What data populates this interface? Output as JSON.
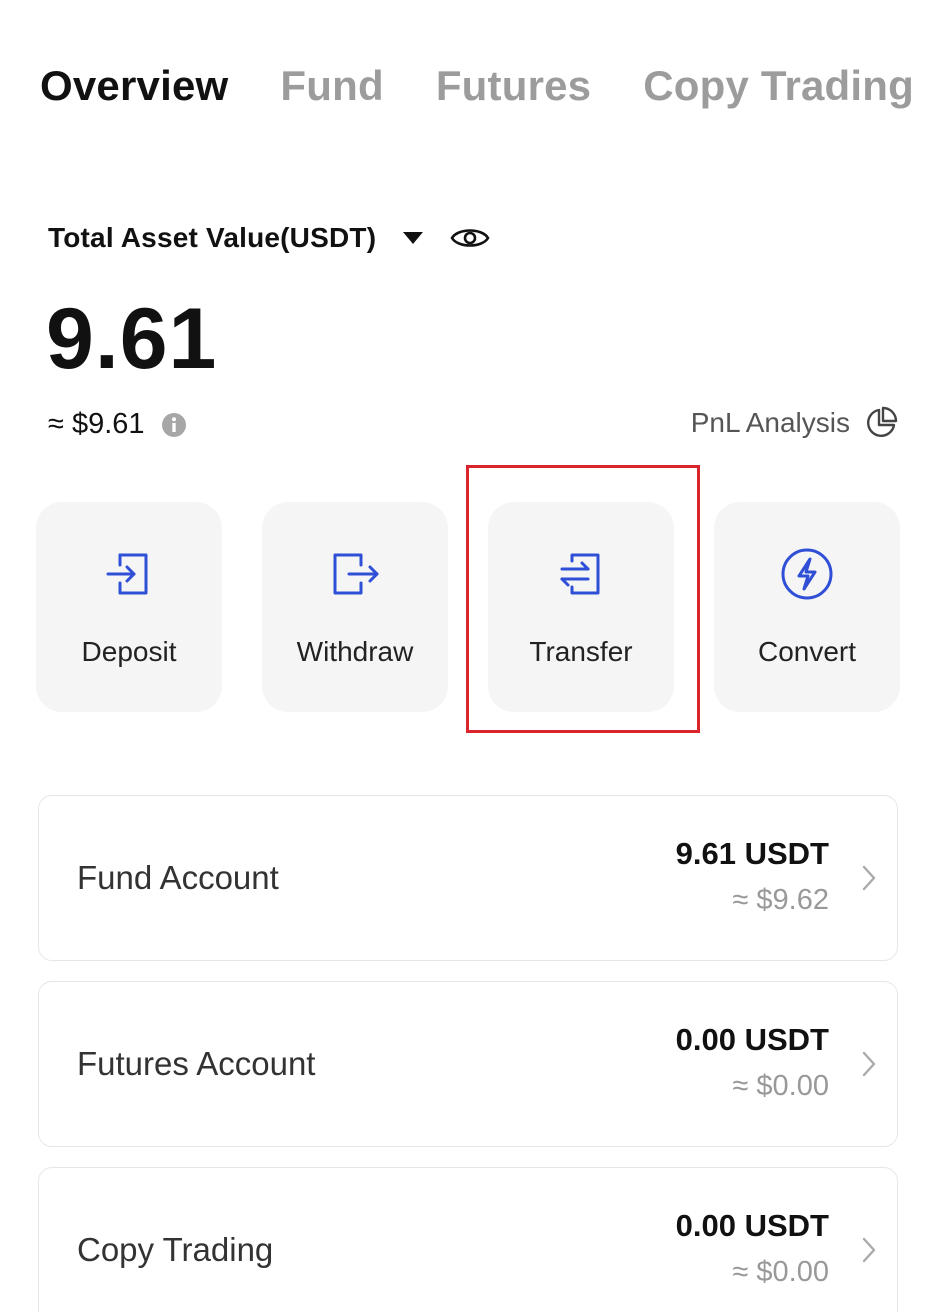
{
  "tabs": [
    {
      "label": "Overview",
      "active": true
    },
    {
      "label": "Fund",
      "active": false
    },
    {
      "label": "Futures",
      "active": false
    },
    {
      "label": "Copy Trading",
      "active": false
    }
  ],
  "summary": {
    "label": "Total Asset Value(USDT)",
    "value": "9.61",
    "approx": "≈ $9.61",
    "pnl_label": "PnL Analysis"
  },
  "actions": [
    {
      "label": "Deposit",
      "icon": "deposit-icon"
    },
    {
      "label": "Withdraw",
      "icon": "withdraw-icon"
    },
    {
      "label": "Transfer",
      "icon": "transfer-icon",
      "highlighted": true
    },
    {
      "label": "Convert",
      "icon": "convert-icon"
    }
  ],
  "accounts": [
    {
      "name": "Fund Account",
      "amount": "9.61 USDT",
      "usd": "≈ $9.62"
    },
    {
      "name": "Futures Account",
      "amount": "0.00 USDT",
      "usd": "≈ $0.00"
    },
    {
      "name": "Copy Trading",
      "amount": "0.00 USDT",
      "usd": "≈ $0.00"
    }
  ],
  "colors": {
    "accent": "#2f4fd6",
    "highlight": "#d9232d",
    "inactive_tab": "#9c9c9c"
  }
}
